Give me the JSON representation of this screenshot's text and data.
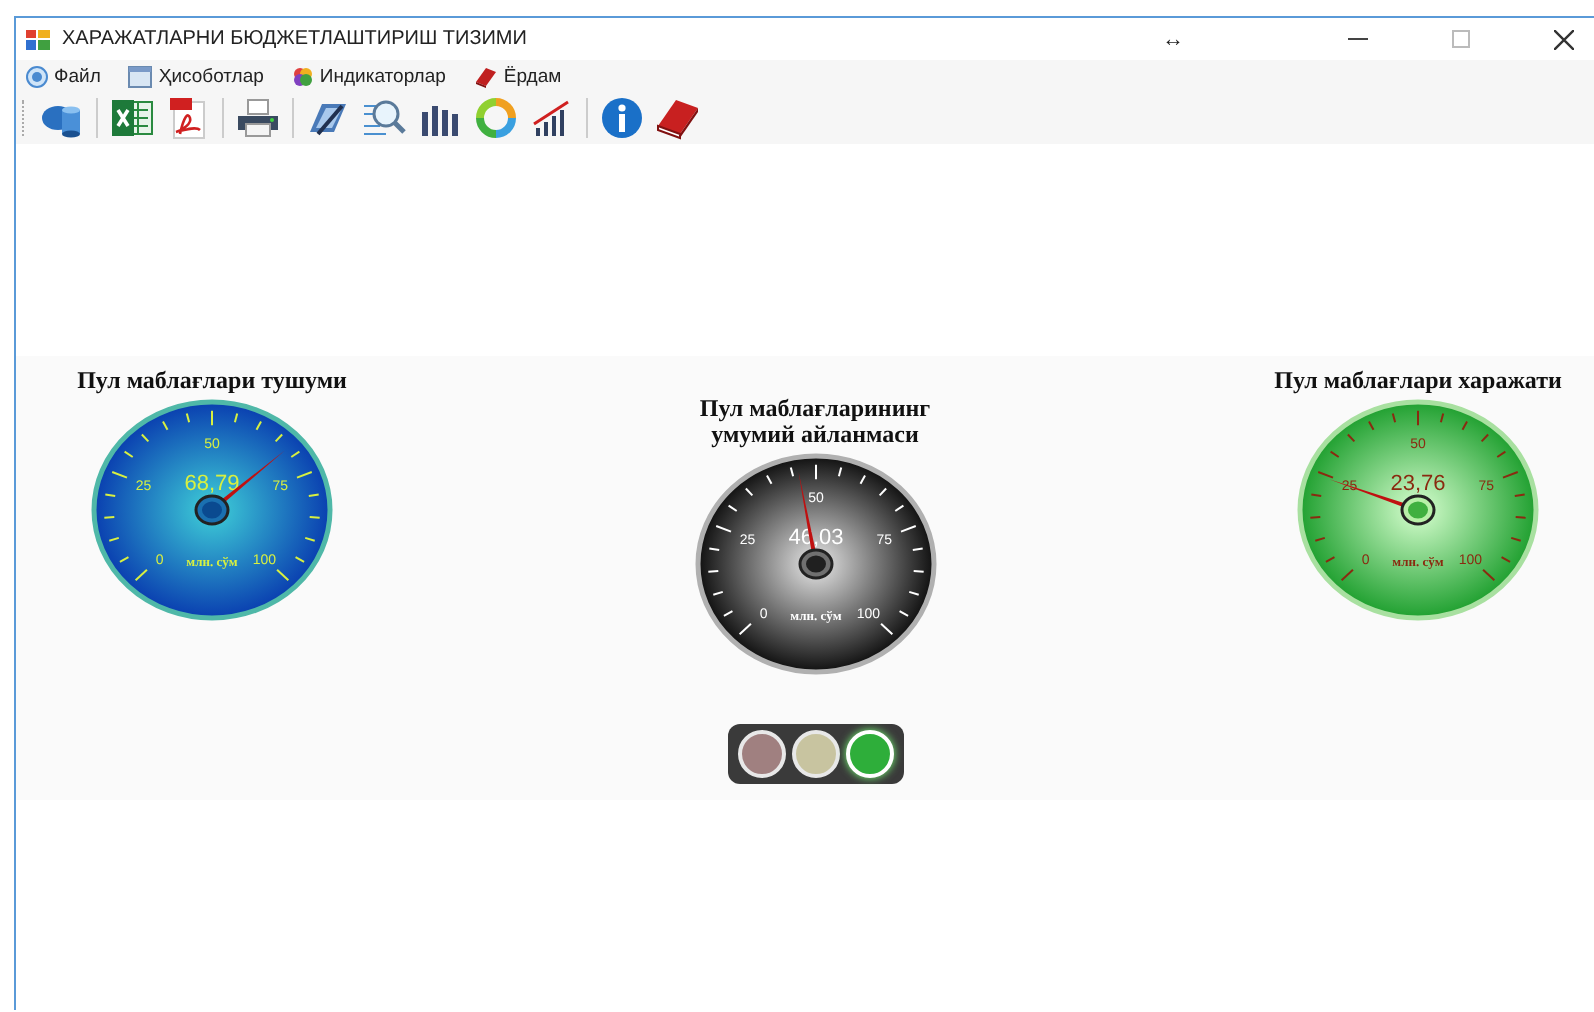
{
  "window": {
    "title": "ХАРАЖАТЛАРНИ  БЮДЖЕТЛАШТИРИШ ТИЗИМИ",
    "resize_glyph": "↔"
  },
  "menu": [
    {
      "label": "Файл",
      "kind": "globe"
    },
    {
      "label": "Ҳисоботлар",
      "kind": "window"
    },
    {
      "label": "Индикаторлар",
      "kind": "palette"
    },
    {
      "label": "Ёрдам",
      "kind": "book"
    }
  ],
  "toolbar": [
    {
      "kind": "database"
    },
    {
      "kind": "excel"
    },
    {
      "kind": "pdf"
    },
    {
      "kind": "printer"
    },
    {
      "kind": "edit"
    },
    {
      "kind": "search"
    },
    {
      "kind": "bars"
    },
    {
      "kind": "ring"
    },
    {
      "kind": "rising"
    },
    {
      "kind": "info"
    },
    {
      "kind": "book"
    }
  ],
  "gauges": [
    {
      "title": "Пул маблағлари тушуми",
      "kind": "blue",
      "value": "68,79",
      "unit": "млн. сўм",
      "level": 0.6879,
      "scale": [
        "0",
        "25",
        "50",
        "75",
        "100"
      ]
    },
    {
      "title": "Пул маблағларининг умумий айланмаси",
      "kind": "dark",
      "value": "46,03",
      "unit": "млн. сўм",
      "level": 0.4603,
      "scale": [
        "0",
        "25",
        "50",
        "75",
        "100"
      ]
    },
    {
      "title": "Пул маблағлари харажати",
      "kind": "green",
      "value": "23,76",
      "unit": "млн. сўм",
      "level": 0.2376,
      "scale": [
        "0",
        "25",
        "50",
        "75",
        "100"
      ]
    }
  ],
  "traffic_light": [
    {
      "color": "#a08080",
      "on": false
    },
    {
      "color": "#c8c4a0",
      "on": false
    },
    {
      "color": "#2eae3a",
      "on": true
    }
  ]
}
